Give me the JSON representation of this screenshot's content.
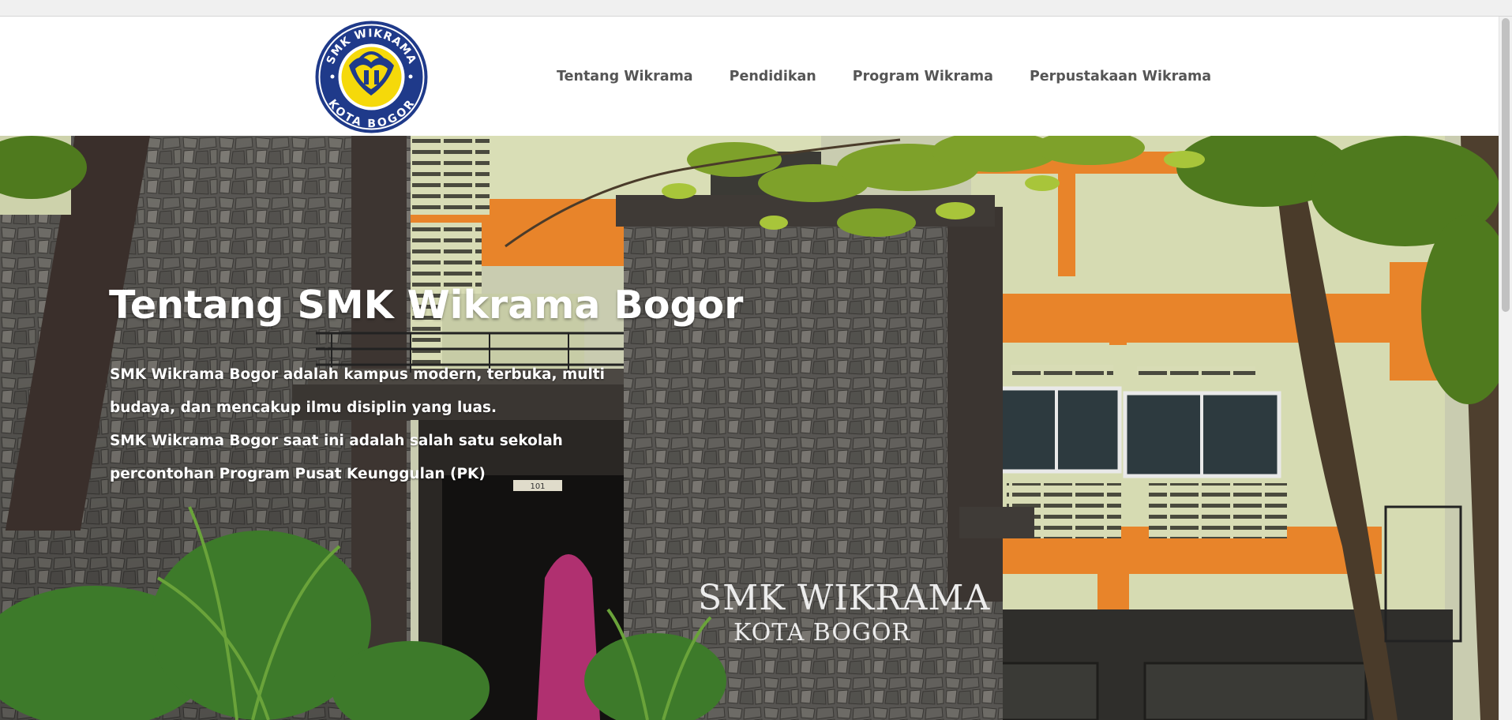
{
  "nav": {
    "logo_alt": "SMK Wikrama Kota Bogor",
    "logo_top_text": "SMK WIKRAMA",
    "logo_bottom_text": "KOTA BOGOR",
    "links": [
      "Tentang Wikrama",
      "Pendidikan",
      "Program Wikrama",
      "Perpustakaan Wikrama"
    ]
  },
  "hero": {
    "title": "Tentang SMK Wikrama Bogor",
    "paragraph_1": "SMK Wikrama Bogor adalah kampus modern, terbuka, multi budaya, dan mencakup ilmu disiplin yang luas.",
    "paragraph_2": "SMK Wikrama Bogor saat ini adalah salah satu sekolah percontohan Program Pusat Keunggulan (PK)",
    "sign_line_1": "SMK WIKRAMA",
    "sign_line_2": "KOTA BOGOR",
    "door_number": "101"
  },
  "colors": {
    "nav_text": "#555555",
    "logo_blue": "#1f3a8a",
    "logo_yellow": "#f5d90a",
    "building_orange": "#e8842a",
    "building_wall": "#d8dcb5",
    "stone_gray": "#666460"
  }
}
